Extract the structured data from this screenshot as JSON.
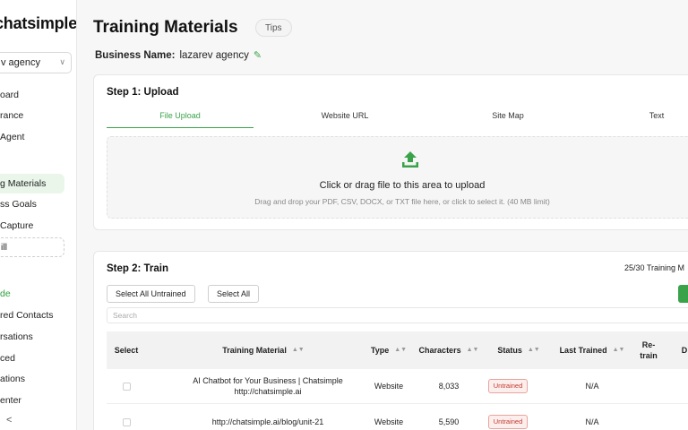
{
  "sidebar": {
    "logo": "chatsimple",
    "agency_select": "v agency",
    "items": [
      {
        "label": "oard"
      },
      {
        "label": "rance"
      },
      {
        "label": "Agent"
      },
      {
        "label": "g Materials"
      },
      {
        "label": "ss Goals"
      },
      {
        "label": "Capture"
      },
      {
        "label": "ill"
      },
      {
        "label": "de"
      },
      {
        "label": "red Contacts"
      },
      {
        "label": "rsations"
      },
      {
        "label": "ced"
      },
      {
        "label": "ations"
      },
      {
        "label": "enter"
      }
    ]
  },
  "header": {
    "title": "Training Materials",
    "tips": "Tips",
    "business_label": "Business Name:",
    "business_value": "lazarev agency"
  },
  "upload": {
    "step_title": "Step 1: Upload",
    "tabs": [
      {
        "label": "File Upload",
        "active": true
      },
      {
        "label": "Website URL"
      },
      {
        "label": "Site Map"
      },
      {
        "label": "Text"
      }
    ],
    "dropzone_title": "Click or drag file to this area to upload",
    "dropzone_sub": "Drag and drop your PDF, CSV, DOCX, or TXT file here, or click to select it. (40 MB limit)"
  },
  "train": {
    "step_title": "Step 2: Train",
    "count": "25/30 Training M",
    "select_all_untrained": "Select All Untrained",
    "select_all": "Select All",
    "search_placeholder": "Search",
    "columns": {
      "select": "Select",
      "material": "Training Material",
      "type": "Type",
      "characters": "Characters",
      "status": "Status",
      "last_trained": "Last Trained",
      "retrain": "Re-\ntrain",
      "d": "D"
    },
    "rows": [
      {
        "material": "AI Chatbot for Your Business | Chatsimple http://chatsimple.ai",
        "type": "Website",
        "characters": "8,033",
        "status": "Untrained",
        "last_trained": "N/A"
      },
      {
        "material": "http://chatsimple.ai/blog/unit-21",
        "type": "Website",
        "characters": "5,590",
        "status": "Untrained",
        "last_trained": "N/A"
      }
    ]
  },
  "colors": {
    "accent": "#3aa34a",
    "untrained": "#c0392b"
  }
}
